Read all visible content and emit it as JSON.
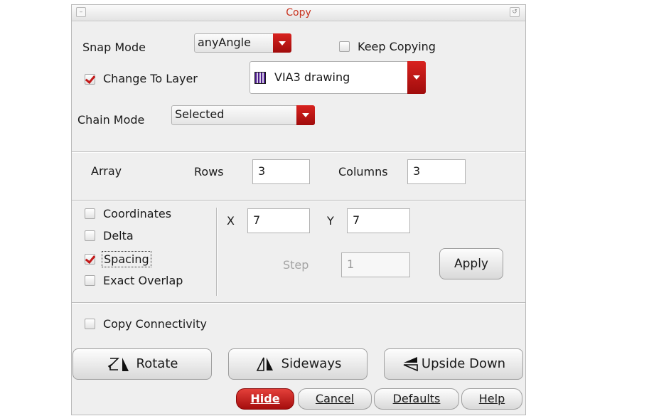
{
  "window": {
    "title": "Copy"
  },
  "snap_mode": {
    "label": "Snap Mode",
    "value": "anyAngle"
  },
  "keep_copying": {
    "label": "Keep Copying",
    "checked": false
  },
  "change_to_layer": {
    "label": "Change To Layer",
    "checked": true,
    "value": "VIA3 drawing",
    "swatch_color": "#4b1a8c"
  },
  "chain_mode": {
    "label": "Chain Mode",
    "value": "Selected"
  },
  "array": {
    "label": "Array",
    "rows_label": "Rows",
    "rows_value": "3",
    "columns_label": "Columns",
    "columns_value": "3"
  },
  "mode_options": [
    {
      "label": "Coordinates",
      "checked": false
    },
    {
      "label": "Delta",
      "checked": false
    },
    {
      "label": "Spacing",
      "checked": true
    },
    {
      "label": "Exact Overlap",
      "checked": false
    }
  ],
  "coords": {
    "x_label": "X",
    "x_value": "7",
    "y_label": "Y",
    "y_value": "7",
    "step_label": "Step",
    "step_value": "1"
  },
  "apply_label": "Apply",
  "copy_connectivity": {
    "label": "Copy Connectivity",
    "checked": false
  },
  "transform_buttons": {
    "rotate": "Rotate",
    "sideways": "Sideways",
    "upside_down": "Upside Down"
  },
  "footer": {
    "hide": "Hide",
    "cancel": "Cancel",
    "defaults": "Defaults",
    "help": "Help"
  },
  "colors": {
    "accent_red": "#c41a1a",
    "title_red": "#c8321e",
    "window_bg": "#efefef"
  }
}
